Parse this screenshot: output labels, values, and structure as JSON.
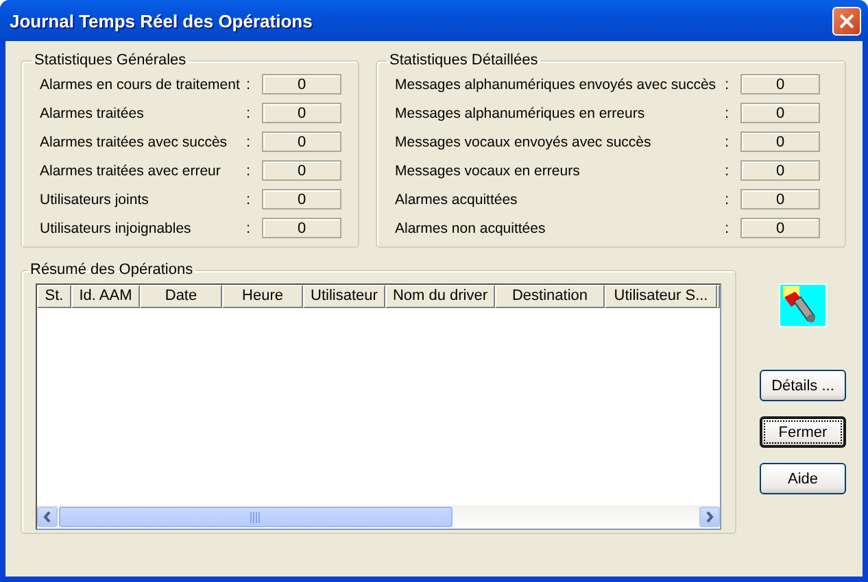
{
  "window": {
    "title": "Journal Temps Réel des Opérations"
  },
  "general_stats": {
    "title": "Statistiques Générales",
    "rows": [
      {
        "label": "Alarmes en cours de traitement",
        "separator": ":",
        "value": "0"
      },
      {
        "label": "Alarmes traitées",
        "separator": ":",
        "value": "0"
      },
      {
        "label": "Alarmes traitées avec succès",
        "separator": ":",
        "value": "0"
      },
      {
        "label": "Alarmes traitées avec erreur",
        "separator": ":",
        "value": "0"
      },
      {
        "label": "Utilisateurs joints",
        "separator": ":",
        "value": "0"
      },
      {
        "label": "Utilisateurs injoignables",
        "separator": ":",
        "value": "0"
      }
    ]
  },
  "detailed_stats": {
    "title": "Statistiques Détaillées",
    "rows": [
      {
        "label": "Messages alphanumériques envoyés avec succès",
        "separator": ":",
        "value": "0"
      },
      {
        "label": "Messages alphanumériques en erreurs",
        "separator": ":",
        "value": "0"
      },
      {
        "label": "Messages vocaux envoyés avec succès",
        "separator": ":",
        "value": "0"
      },
      {
        "label": "Messages vocaux en erreurs",
        "separator": ":",
        "value": "0"
      },
      {
        "label": "Alarmes acquittées",
        "separator": ":",
        "value": "0"
      },
      {
        "label": "Alarmes non acquittées",
        "separator": ":",
        "value": "0"
      }
    ]
  },
  "summary": {
    "title": "Résumé des Opérations",
    "table": {
      "columns": [
        "St.",
        "Id. AAM",
        "Date",
        "Heure",
        "Utilisateur",
        "Nom du driver",
        "Destination",
        "Utilisateur S..."
      ]
    }
  },
  "buttons": [
    {
      "label": "Détails ...",
      "default": false
    },
    {
      "label": "Fermer",
      "default": true
    },
    {
      "label": "Aide",
      "default": false
    }
  ]
}
